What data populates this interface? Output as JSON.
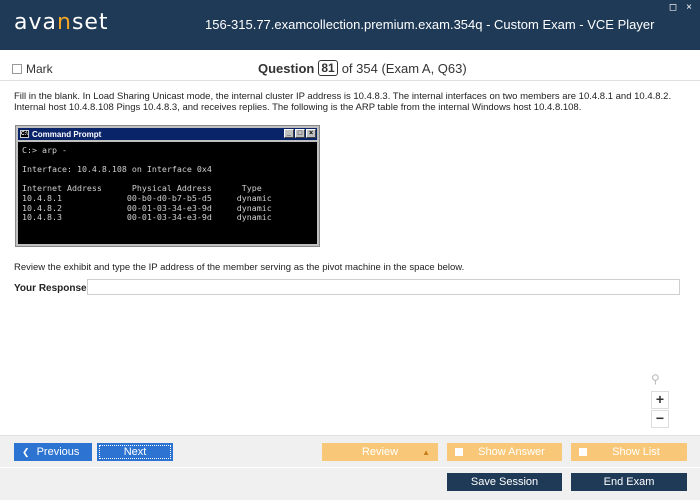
{
  "window": {
    "logo_pre": "ava",
    "logo_accent": "n",
    "logo_post": "set",
    "title": "156-315.77.examcollection.premium.exam.354q - Custom Exam - VCE Player",
    "controls": [
      "◻",
      "×"
    ]
  },
  "header": {
    "mark_label": "Mark",
    "question_label": "Question",
    "question_number": "81",
    "question_total": "of 354 (Exam A, Q63)"
  },
  "question": {
    "text": "Fill in the blank. In Load Sharing Unicast mode, the internal cluster IP address is 10.4.8.3. The internal interfaces on two members are 10.4.8.1 and 10.4.8.2. Internal host 10.4.8.108 Pings 10.4.8.3, and receives replies. The following is the ARP table from the internal Windows host 10.4.8.108.",
    "instruction": "Review the exhibit and type the IP address of the member serving as the pivot machine in the space below."
  },
  "exhibit": {
    "title": "Command Prompt",
    "icon_text": "C:\\",
    "buttons": [
      "_",
      "□",
      "×"
    ],
    "lines": [
      "C:> arp -",
      "",
      "Interface: 10.4.8.108 on Interface 0x4",
      "",
      "Internet Address      Physical Address      Type",
      "10.4.8.1             00-b0-d0-b7-b5-d5     dynamic",
      "10.4.8.2             00-01-03-34-e3-9d     dynamic",
      "10.4.8.3             00-01-03-34-e3-9d     dynamic"
    ]
  },
  "response": {
    "label": "Your Response:",
    "value": ""
  },
  "zoom": {
    "search_icon": "⚲",
    "plus": "+",
    "minus": "−"
  },
  "nav": {
    "previous": "Previous",
    "next": "Next",
    "review": "Review",
    "show_answer": "Show Answer",
    "show_list": "Show List"
  },
  "actions": {
    "save_session": "Save Session",
    "end_exam": "End Exam"
  },
  "colors": {
    "titlebar": "#1f3a57",
    "accent": "#f5a623",
    "blue_button": "#2c73d2",
    "orange_button": "#f8c878"
  }
}
